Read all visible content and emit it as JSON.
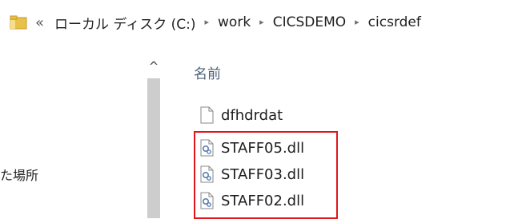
{
  "address_bar": {
    "overflow_glyph": "«",
    "crumbs": [
      "ローカル ディスク (C:)",
      "work",
      "CICSDEMO",
      "cicsrdef"
    ],
    "separator": "▸"
  },
  "nav_pane": {
    "partial_item": "た場所"
  },
  "scrollbar": {
    "up_arrow": "^"
  },
  "file_list": {
    "column_header": "名前",
    "files": [
      {
        "name": "dfhdrdat",
        "icon": "blank-file-icon"
      },
      {
        "name": "STAFF05.dll",
        "icon": "dll-file-icon"
      },
      {
        "name": "STAFF03.dll",
        "icon": "dll-file-icon"
      },
      {
        "name": "STAFF02.dll",
        "icon": "dll-file-icon"
      }
    ]
  },
  "colors": {
    "highlight_border": "#e0161b",
    "header_text": "#4c607a",
    "folder_icon": "#e8c04a"
  }
}
